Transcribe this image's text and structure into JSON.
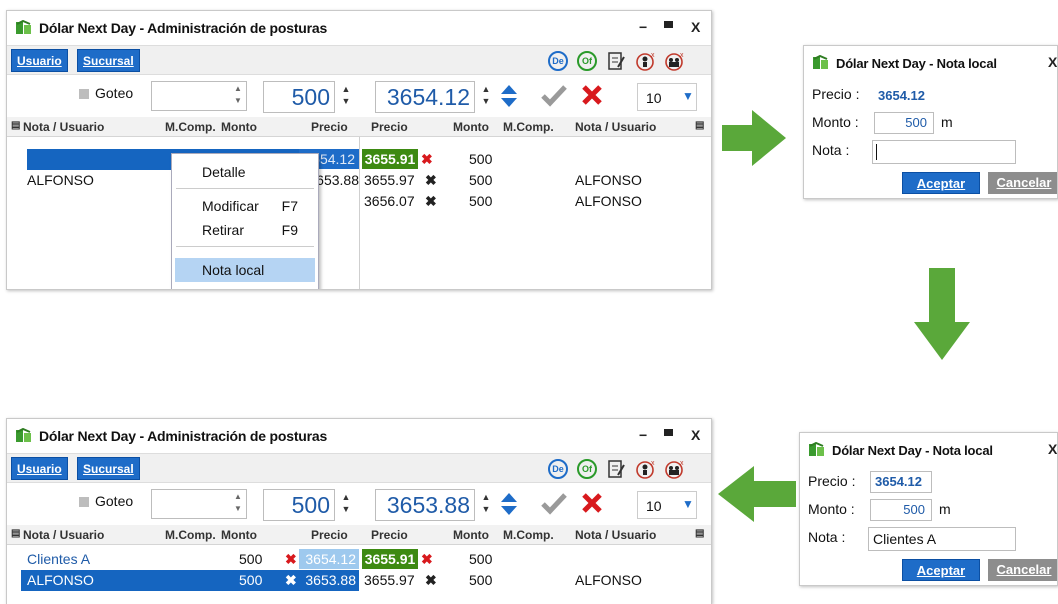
{
  "colors": {
    "accent_blue": "#1e6cc8",
    "select_blue": "#1565c0",
    "price_blue_bg": "#9ec9ee",
    "price_green_bg": "#3d8a12",
    "arrow_green": "#5aa83a",
    "cancel_grey": "#8d8d8d"
  },
  "icons": [
    "app-logo-icon",
    "minimize-icon",
    "maximize-icon",
    "close-icon",
    "de-icon",
    "of-icon",
    "edit-form-icon",
    "user-remove-icon",
    "users-remove-icon",
    "spin-up-icon",
    "spin-down-icon",
    "big-spin-icon",
    "checkmark-icon",
    "cross-icon",
    "dropdown-arrow-icon",
    "column-menu-icon",
    "arrow-right",
    "arrow-down",
    "arrow-left"
  ],
  "main_top": {
    "title": "Dólar Next Day - Administración de posturas",
    "min": "−",
    "max": "▫",
    "close": "X",
    "tabs": [
      "Usuario",
      "Sucursal"
    ],
    "toolbar_icons": {
      "de": "De",
      "of": "Of"
    },
    "goteo": "Goteo",
    "monto": "500",
    "precio": "3654.12",
    "count": "10",
    "headers": {
      "nota_izq": "Nota / Usuario",
      "mcomp_izq": "M.Comp.",
      "monto_izq": "Monto",
      "precio_c": "Precio",
      "precio_v": "Precio",
      "monto_der": "Monto",
      "mcomp_der": "M.Comp.",
      "nota_der": "Nota / Usuario"
    },
    "rows": [
      {
        "nota_izq": "",
        "precio_c": "3654.12",
        "precio_v": "3655.91",
        "x": "✖",
        "monto_der": "500",
        "nota_der": ""
      },
      {
        "nota_izq": "ALFONSO",
        "precio_c": "3653.88",
        "precio_v": "3655.97",
        "x": "✖",
        "monto_der": "500",
        "nota_der": "ALFONSO"
      },
      {
        "precio_v": "3656.07",
        "x": "✖",
        "monto_der": "500",
        "nota_der": "ALFONSO"
      }
    ],
    "menu": {
      "detalle": "Detalle",
      "modificar": "Modificar",
      "modificar_sc": "F7",
      "retirar": "Retirar",
      "retirar_sc": "F9",
      "nota_local": "Nota local"
    }
  },
  "main_bottom": {
    "title": "Dólar Next Day - Administración de posturas",
    "min": "−",
    "max": "▫",
    "close": "X",
    "tabs": [
      "Usuario",
      "Sucursal"
    ],
    "toolbar_icons": {
      "de": "De",
      "of": "Of"
    },
    "goteo": "Goteo",
    "monto": "500",
    "precio": "3653.88",
    "count": "10",
    "headers": {
      "nota_izq": "Nota / Usuario",
      "mcomp_izq": "M.Comp.",
      "monto_izq": "Monto",
      "precio_c": "Precio",
      "precio_v": "Precio",
      "monto_der": "Monto",
      "mcomp_der": "M.Comp.",
      "nota_der": "Nota / Usuario"
    },
    "rows": [
      {
        "nota_izq": "Clientes A",
        "monto_izq": "500",
        "xc": "✖",
        "precio_c": "3654.12",
        "precio_v": "3655.91",
        "x": "✖",
        "monto_der": "500",
        "nota_der": ""
      },
      {
        "nota_izq": "ALFONSO",
        "monto_izq": "500",
        "xc": "✖",
        "precio_c": "3653.88",
        "precio_v": "3655.97",
        "x": "✖",
        "monto_der": "500",
        "nota_der": "ALFONSO"
      }
    ]
  },
  "nota_top": {
    "title": "Dólar Next Day - Nota local",
    "close": "X",
    "precio_label": "Precio :",
    "precio": "3654.12",
    "monto_label": "Monto :",
    "monto": "500",
    "unit": "m",
    "nota_label": "Nota :",
    "nota": "",
    "aceptar": "Aceptar",
    "cancelar": "Cancelar"
  },
  "nota_bottom": {
    "title": "Dólar Next Day - Nota local",
    "close": "X",
    "precio_label": "Precio :",
    "precio": "3654.12",
    "monto_label": "Monto :",
    "monto": "500",
    "unit": "m",
    "nota_label": "Nota :",
    "nota": "Clientes A",
    "aceptar": "Aceptar",
    "cancelar": "Cancelar"
  }
}
